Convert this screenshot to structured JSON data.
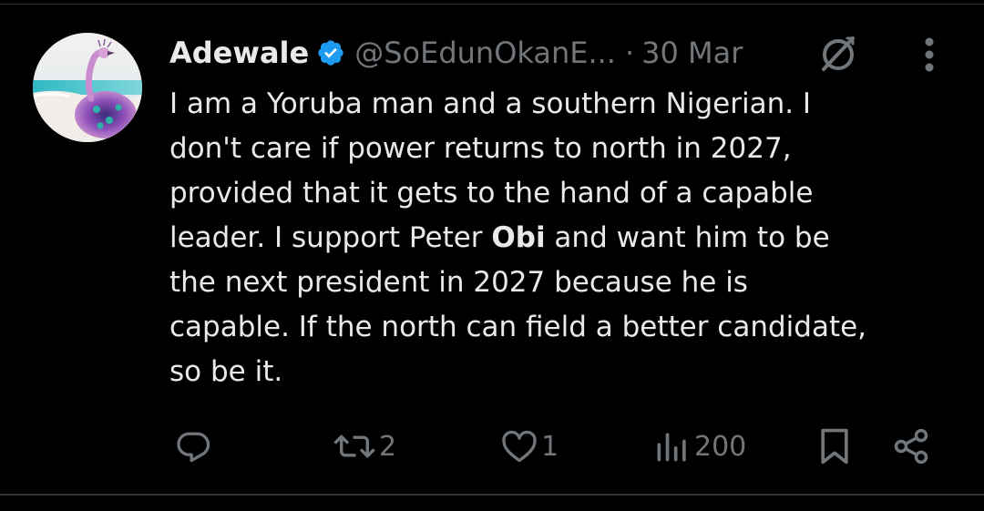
{
  "tweet": {
    "author": {
      "name": "Adewale",
      "handle": "@SoEdunOkanE...",
      "verified": true,
      "avatar_icon": "peacock-avatar"
    },
    "separator": "·",
    "date": "30 Mar",
    "body": {
      "part1": "I am a Yoruba man and a southern Nigerian. I\ndon't care if power returns to north in 2027,\nprovided that it gets to the hand of a capable\nleader. I support Peter ",
      "bold": "Obi",
      "part2": " and want him to be\nthe next president in 2027 because he is\ncapable. If the north can field a better candidate,\nso be it."
    },
    "actions": {
      "reply_icon": "reply-icon",
      "retweet_count": "2",
      "like_count": "1",
      "views_count": "200",
      "bookmark_icon": "bookmark-icon",
      "share_icon": "share-icon"
    },
    "colors": {
      "background": "#000000",
      "text": "#e7e9ea",
      "muted": "#71767b",
      "verified_badge": "#1d9bf0",
      "divider": "#2f3336"
    }
  }
}
